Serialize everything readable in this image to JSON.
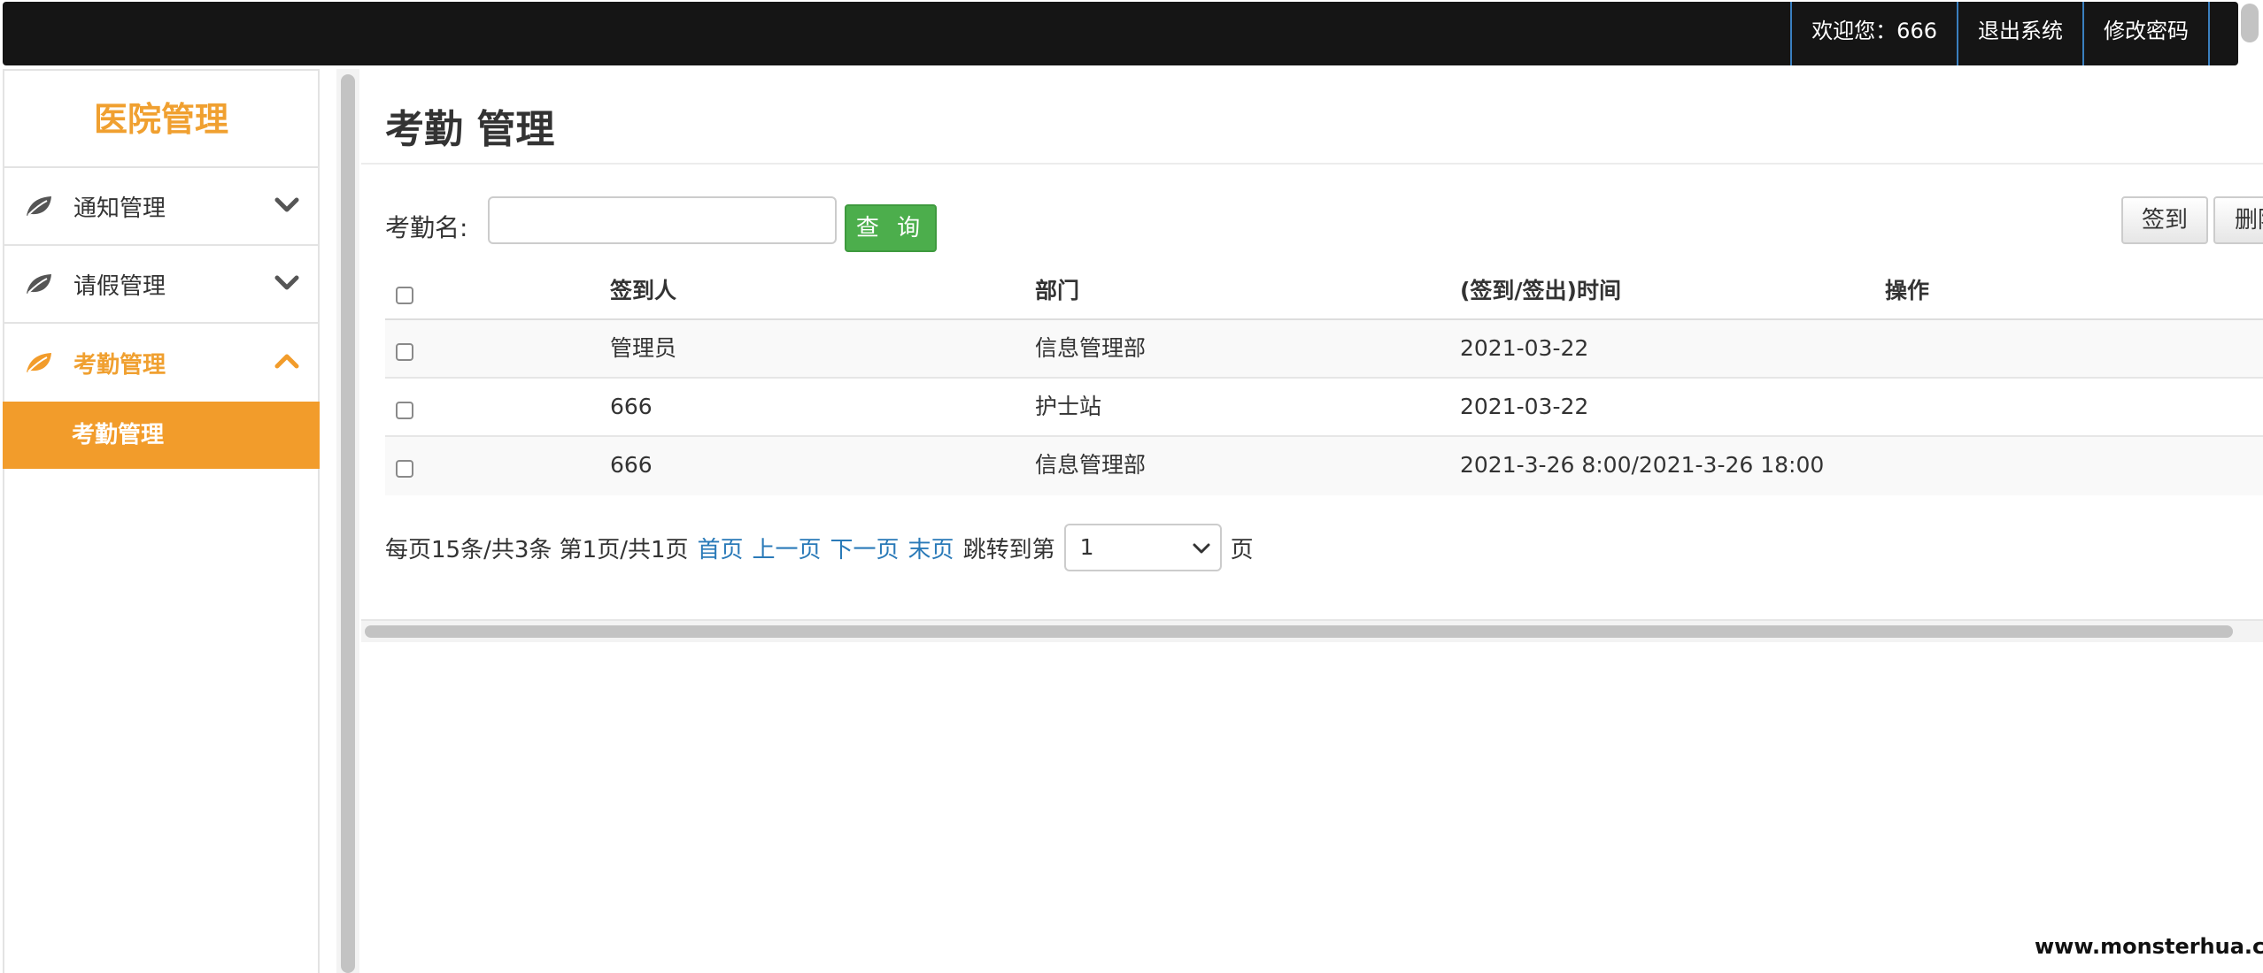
{
  "topbar": {
    "welcome": "欢迎您：666",
    "logout": "退出系统",
    "change_password": "修改密码"
  },
  "sidebar": {
    "brand": "医院管理",
    "items": [
      {
        "label": "通知管理",
        "icon": "leaf-icon",
        "expanded": false
      },
      {
        "label": "请假管理",
        "icon": "leaf-icon",
        "expanded": false
      },
      {
        "label": "考勤管理",
        "icon": "leaf-icon",
        "expanded": true,
        "children": [
          {
            "label": "考勤管理",
            "active": true
          }
        ]
      }
    ]
  },
  "main": {
    "title": "考勤 管理",
    "search": {
      "label": "考勤名:",
      "value": "",
      "placeholder": ""
    },
    "buttons": {
      "query": "查 询",
      "sign": "签到",
      "delete": "删除"
    },
    "table": {
      "headers": [
        "签到人",
        "部门",
        "(签到/签出)时间",
        "操作"
      ],
      "rows": [
        {
          "person": "管理员",
          "department": "信息管理部",
          "time": "2021-03-22",
          "action": ""
        },
        {
          "person": "666",
          "department": "护士站",
          "time": "2021-03-22",
          "action": ""
        },
        {
          "person": "666",
          "department": "信息管理部",
          "time": "2021-3-26 8:00/2021-3-26 18:00",
          "action": ""
        }
      ]
    },
    "pagination": {
      "summary": "每页15条/共3条 第1页/共1页",
      "first": "首页",
      "prev": "上一页",
      "next": "下一页",
      "last": "末页",
      "jump_prefix": "跳转到第",
      "jump_value": "1",
      "jump_suffix": "页"
    }
  },
  "watermark": "www.monsterhua.com",
  "colors": {
    "accent_orange": "#f29c2b",
    "topbar_bg": "#151515",
    "query_green": "#4cae4c",
    "link_blue": "#2a7ab8"
  }
}
